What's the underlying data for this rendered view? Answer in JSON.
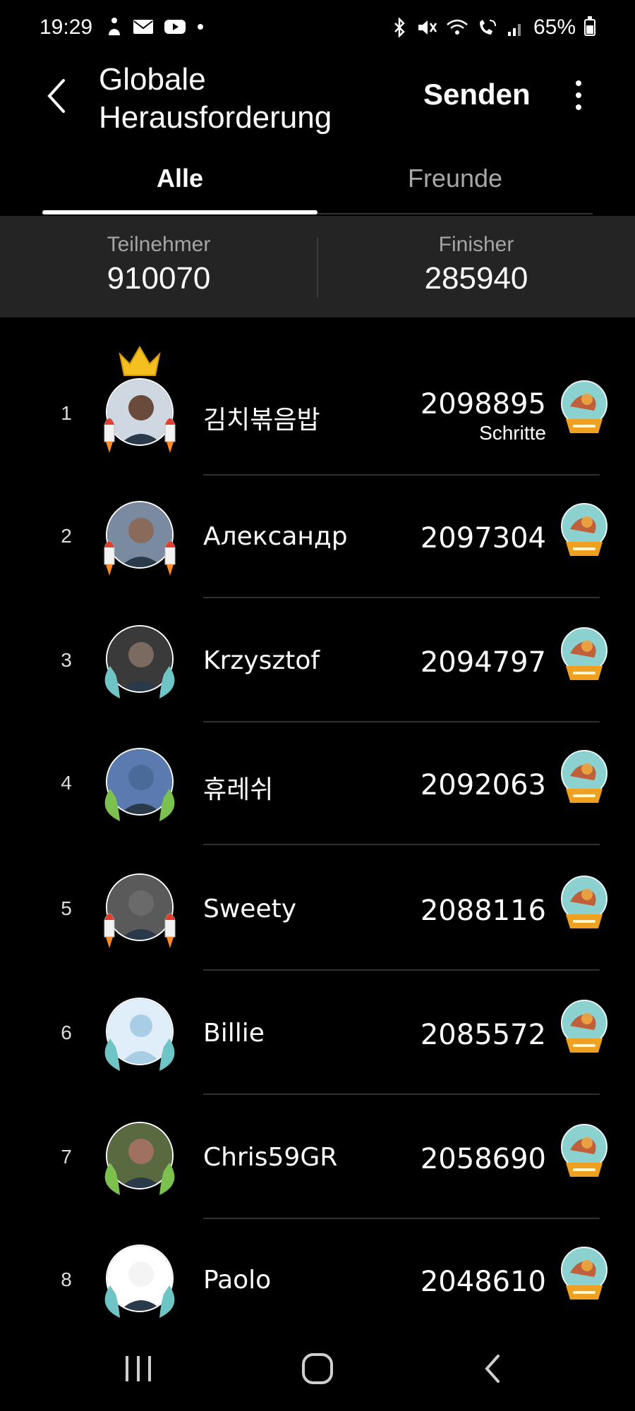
{
  "status_bar": {
    "time": "19:29",
    "battery": "65%",
    "battery_level": 0.65,
    "left_icons": [
      "accessibility-icon",
      "mail-icon",
      "youtube-icon",
      "dot-icon"
    ],
    "right_icons": [
      "bluetooth-icon",
      "mute-icon",
      "wifi-icon",
      "wifi-call-icon",
      "signal-icon",
      "battery-icon"
    ]
  },
  "header": {
    "title_line1": "Globale",
    "title_line2": "Herausforderung",
    "send_label": "Senden"
  },
  "tabs": {
    "all": "Alle",
    "friends": "Freunde",
    "active": "all"
  },
  "stats": {
    "participants_label": "Teilnehmer",
    "participants_value": "910070",
    "finishers_label": "Finisher",
    "finishers_value": "285940"
  },
  "leaderboard": [
    {
      "rank": "1",
      "name": "김치볶음밥",
      "steps": "2098895",
      "unit": "Schritte",
      "badge": "rocket",
      "crown": true
    },
    {
      "rank": "2",
      "name": "Александр",
      "steps": "2097304",
      "badge": "rocket"
    },
    {
      "rank": "3",
      "name": "Krzysztof",
      "steps": "2094797",
      "badge": "wings-blue"
    },
    {
      "rank": "4",
      "name": "휴레쉬",
      "steps": "2092063",
      "badge": "wings-green"
    },
    {
      "rank": "5",
      "name": "Sweety",
      "steps": "2088116",
      "badge": "rocket"
    },
    {
      "rank": "6",
      "name": "Billie",
      "steps": "2085572",
      "badge": "wings-blue"
    },
    {
      "rank": "7",
      "name": "Chris59GR",
      "steps": "2058690",
      "badge": "wings-green"
    },
    {
      "rank": "8",
      "name": "Paolo",
      "steps": "2048610",
      "badge": "wings-blue"
    }
  ],
  "colors": {
    "background": "#000000",
    "stats_band": "#242424",
    "muted_text": "#a4a4a4",
    "tab_indicator": "#ffffff",
    "trophy_gold": "#f0a020",
    "trophy_globe": "#8ad1cf"
  }
}
